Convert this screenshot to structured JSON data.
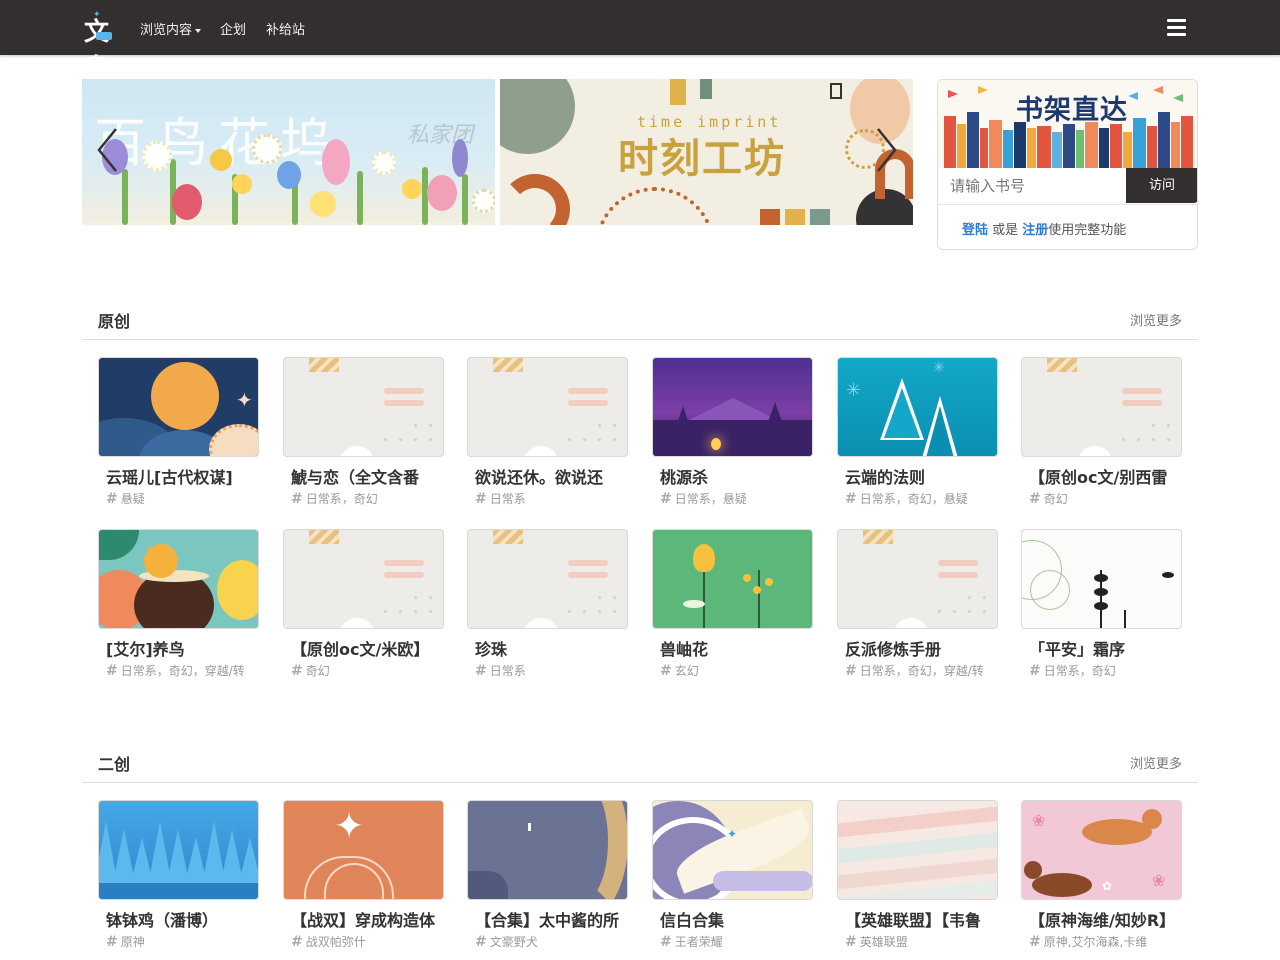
{
  "nav": {
    "logo_text": "文鸟",
    "links": [
      {
        "label": "浏览内容",
        "has_caret": true
      },
      {
        "label": "企划"
      },
      {
        "label": "补给站"
      }
    ]
  },
  "carousel": {
    "slides": [
      {
        "title": "百鸟花坞",
        "subtitle": "私家团"
      },
      {
        "title": "时刻工坊",
        "subtitle": "time imprint"
      }
    ],
    "active_index": 0,
    "indicator_count": 3
  },
  "shelf": {
    "banner_title": "书架直达",
    "input_placeholder": "请输入书号",
    "visit_label": "访问",
    "login_label": "登陆",
    "or_text": " 或是 ",
    "register_label": "注册",
    "suffix_text": "使用完整功能"
  },
  "sections": [
    {
      "title": "原创",
      "more_label": "浏览更多",
      "items": [
        {
          "title": "云瑶儿[古代权谋]",
          "tags": "悬疑",
          "cover": "moon-night"
        },
        {
          "title": "鯱与恋（全文含番",
          "tags": "日常系，奇幻",
          "cover": "placeholder"
        },
        {
          "title": "欲说还休。欲说还",
          "tags": "日常系",
          "cover": "placeholder"
        },
        {
          "title": "桃源杀",
          "tags": "日常系，悬疑",
          "cover": "purple-forest"
        },
        {
          "title": "云端的法则",
          "tags": "日常系，奇幻，悬疑",
          "cover": "teal-trees"
        },
        {
          "title": "【原创oc文/别西雷",
          "tags": "奇幻",
          "cover": "placeholder"
        },
        {
          "title": "[艾尔]养鸟",
          "tags": "日常系，奇幻，穿越/转",
          "cover": "coconut-drink"
        },
        {
          "title": "【原创oc文/米欧】",
          "tags": "奇幻",
          "cover": "placeholder"
        },
        {
          "title": "珍珠",
          "tags": "日常系",
          "cover": "placeholder"
        },
        {
          "title": "兽岫花",
          "tags": "玄幻",
          "cover": "green-flowers"
        },
        {
          "title": "反派修炼手册",
          "tags": "日常系，奇幻，穿越/转",
          "cover": "placeholder"
        },
        {
          "title": "「平安」霜序",
          "tags": "日常系，奇幻",
          "cover": "line-plants"
        }
      ]
    },
    {
      "title": "二创",
      "more_label": "浏览更多",
      "items": [
        {
          "title": "钵钵鸡（潘博）",
          "tags": "原神",
          "cover": "blue-forest"
        },
        {
          "title": "【战双】穿成构造体",
          "tags": "战双帕弥什",
          "cover": "orange-hand"
        },
        {
          "title": "【合集】太中酱的所",
          "tags": "文豪野犬",
          "cover": "slate-curve"
        },
        {
          "title": "信白合集",
          "tags": "王者荣耀",
          "cover": "white-dragon"
        },
        {
          "title": "【英雄联盟】【韦鲁",
          "tags": "英雄联盟",
          "cover": "pastel-waves"
        },
        {
          "title": "【原神海维/知妙R】",
          "tags": "原神,艾尔海森,卡维",
          "cover": "pink-horses"
        }
      ]
    }
  ],
  "colors": {
    "navbar_bg": "#332f2e",
    "link_blue": "#2f7cd6",
    "visit_button_bg": "#332f2e"
  }
}
